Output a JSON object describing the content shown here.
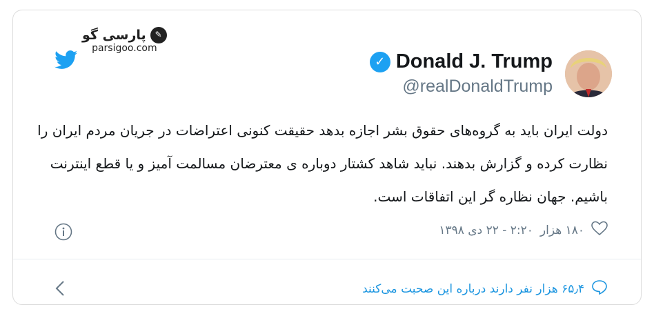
{
  "watermark": {
    "title": "پارسی گو",
    "url": "parsigoo.com"
  },
  "author": {
    "name": "Donald J. Trump",
    "handle": "@realDonaldTrump"
  },
  "tweet": {
    "text": "دولت ایران باید به گروه‌های حقوق بشر اجازه بدهد حقیقت کنونی اعتراضات در جریان مردم ایران را نظارت کرده و گزارش بدهند. نباید شاهد کشتار دوباره ی معترضان مسالمت آمیز و یا قطع اینترنت باشیم. جهان نظاره گر این اتفاقات است."
  },
  "meta": {
    "likes": "۱۸۰ هزار",
    "date": "۲:۲۰ - ۲۲ دی ۱۳۹۸"
  },
  "footer": {
    "conversation": "۶۵٫۴ هزار نفر دارند درباره این صحبت می‌کنند"
  },
  "colors": {
    "accent": "#1da1f2",
    "link": "#1b95e0",
    "muted": "#657786"
  },
  "icons": {
    "twitter": "twitter-bird-icon",
    "verified": "verified-badge-icon",
    "heart": "heart-icon",
    "info": "info-icon",
    "reply": "speech-bubble-icon",
    "chevron": "chevron-left-icon"
  }
}
